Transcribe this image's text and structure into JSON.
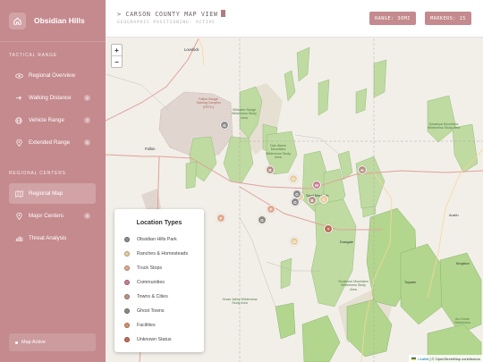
{
  "brand": {
    "name": "Obsidian Hills"
  },
  "sidebar": {
    "tactical_title": "TACTICAL RANGE",
    "items": [
      {
        "label": "Regional Overview",
        "icon": "eye-icon",
        "badge": ""
      },
      {
        "label": "Walking Distance",
        "icon": "arrow-right-icon",
        "badge": "2"
      },
      {
        "label": "Vehicle Range",
        "icon": "globe-icon",
        "badge": "3"
      },
      {
        "label": "Extended Range",
        "icon": "pin-icon",
        "badge": "5"
      }
    ],
    "regional_title": "REGIONAL CENTERS",
    "centers": [
      {
        "label": "Regional Map",
        "icon": "map-icon",
        "badge": "",
        "active": true
      },
      {
        "label": "Major Centers",
        "icon": "pin-icon",
        "badge": "4"
      },
      {
        "label": "Threat Analysis",
        "icon": "chart-icon",
        "badge": ""
      }
    ],
    "status": "Map Active"
  },
  "header": {
    "title": "> CARSON COUNTY MAP VIEW",
    "subtitle": "GEOGRAPHIC POSITIONING: ACTIVE",
    "range_badge": "RANGE: 30MI",
    "markers_badge": "MARKERS: 15"
  },
  "map": {
    "zoom_in": "+",
    "zoom_out": "−",
    "labels": {
      "lovelock": "Lovelock",
      "fallon": "Fallon",
      "fallon_range": "Fallon Range Training Complex (FRTC)",
      "stillwater": "Stillwater Range Wilderness Study Area",
      "clan_alpine": "Clan Alpine Mountains Wilderness Study Area",
      "desatoya": "Desatoya Mountains Wilderness Study Area",
      "grass_valley": "Grass Valley Wilderness Study Area",
      "shoshone": "Shoshone Mountains Wilderness Study Area",
      "sand_mountain": "Sand Mountain",
      "eastgate": "Eastgate",
      "austin": "Austin",
      "kingston": "Kingston",
      "toiyabe": "Toiyabe",
      "arc_dome": "Arc Dome Wilderness"
    },
    "colors": {
      "park": "#8c8c8c",
      "ranch": "#e7cc9c",
      "truckstop": "#e0a98a",
      "community": "#c97f93",
      "town": "#b79386",
      "ghost": "#8a8a7a",
      "facility": "#cf956e",
      "unknown": "#bd6d56"
    },
    "markers": [
      {
        "type": "park",
        "letter": "G"
      },
      {
        "type": "town",
        "letter": "R"
      },
      {
        "type": "ranch",
        "letter": "O"
      },
      {
        "type": "community",
        "letter": "M"
      },
      {
        "type": "ranch",
        "letter": "C"
      },
      {
        "type": "park",
        "letter": "G"
      },
      {
        "type": "town",
        "letter": "B"
      },
      {
        "type": "truckstop",
        "letter": "F"
      },
      {
        "type": "ghost",
        "letter": "G"
      },
      {
        "type": "unknown",
        "letter": "?"
      },
      {
        "type": "ranch",
        "letter": "O"
      },
      {
        "type": "town",
        "letter": "H"
      },
      {
        "type": "truckstop",
        "letter": "F"
      },
      {
        "type": "ranch",
        "letter": "C"
      },
      {
        "type": "park",
        "letter": "G"
      }
    ]
  },
  "legend": {
    "title": "Location Types",
    "items": [
      {
        "label": "Obsidian Hills Park",
        "color": "#8c8c8c"
      },
      {
        "label": "Ranches & Homesteads",
        "color": "#e7cc9c"
      },
      {
        "label": "Truck Stops",
        "color": "#e0a98a"
      },
      {
        "label": "Communities",
        "color": "#c97f93"
      },
      {
        "label": "Towns & Cities",
        "color": "#b79386"
      },
      {
        "label": "Ghost Towns",
        "color": "#8a8a7a"
      },
      {
        "label": "Facilities",
        "color": "#cf956e"
      },
      {
        "label": "Unknown Status",
        "color": "#bd6d56"
      }
    ]
  },
  "attribution": {
    "leaflet": "Leaflet",
    "rest": "| © OpenStreetMap contributors"
  }
}
